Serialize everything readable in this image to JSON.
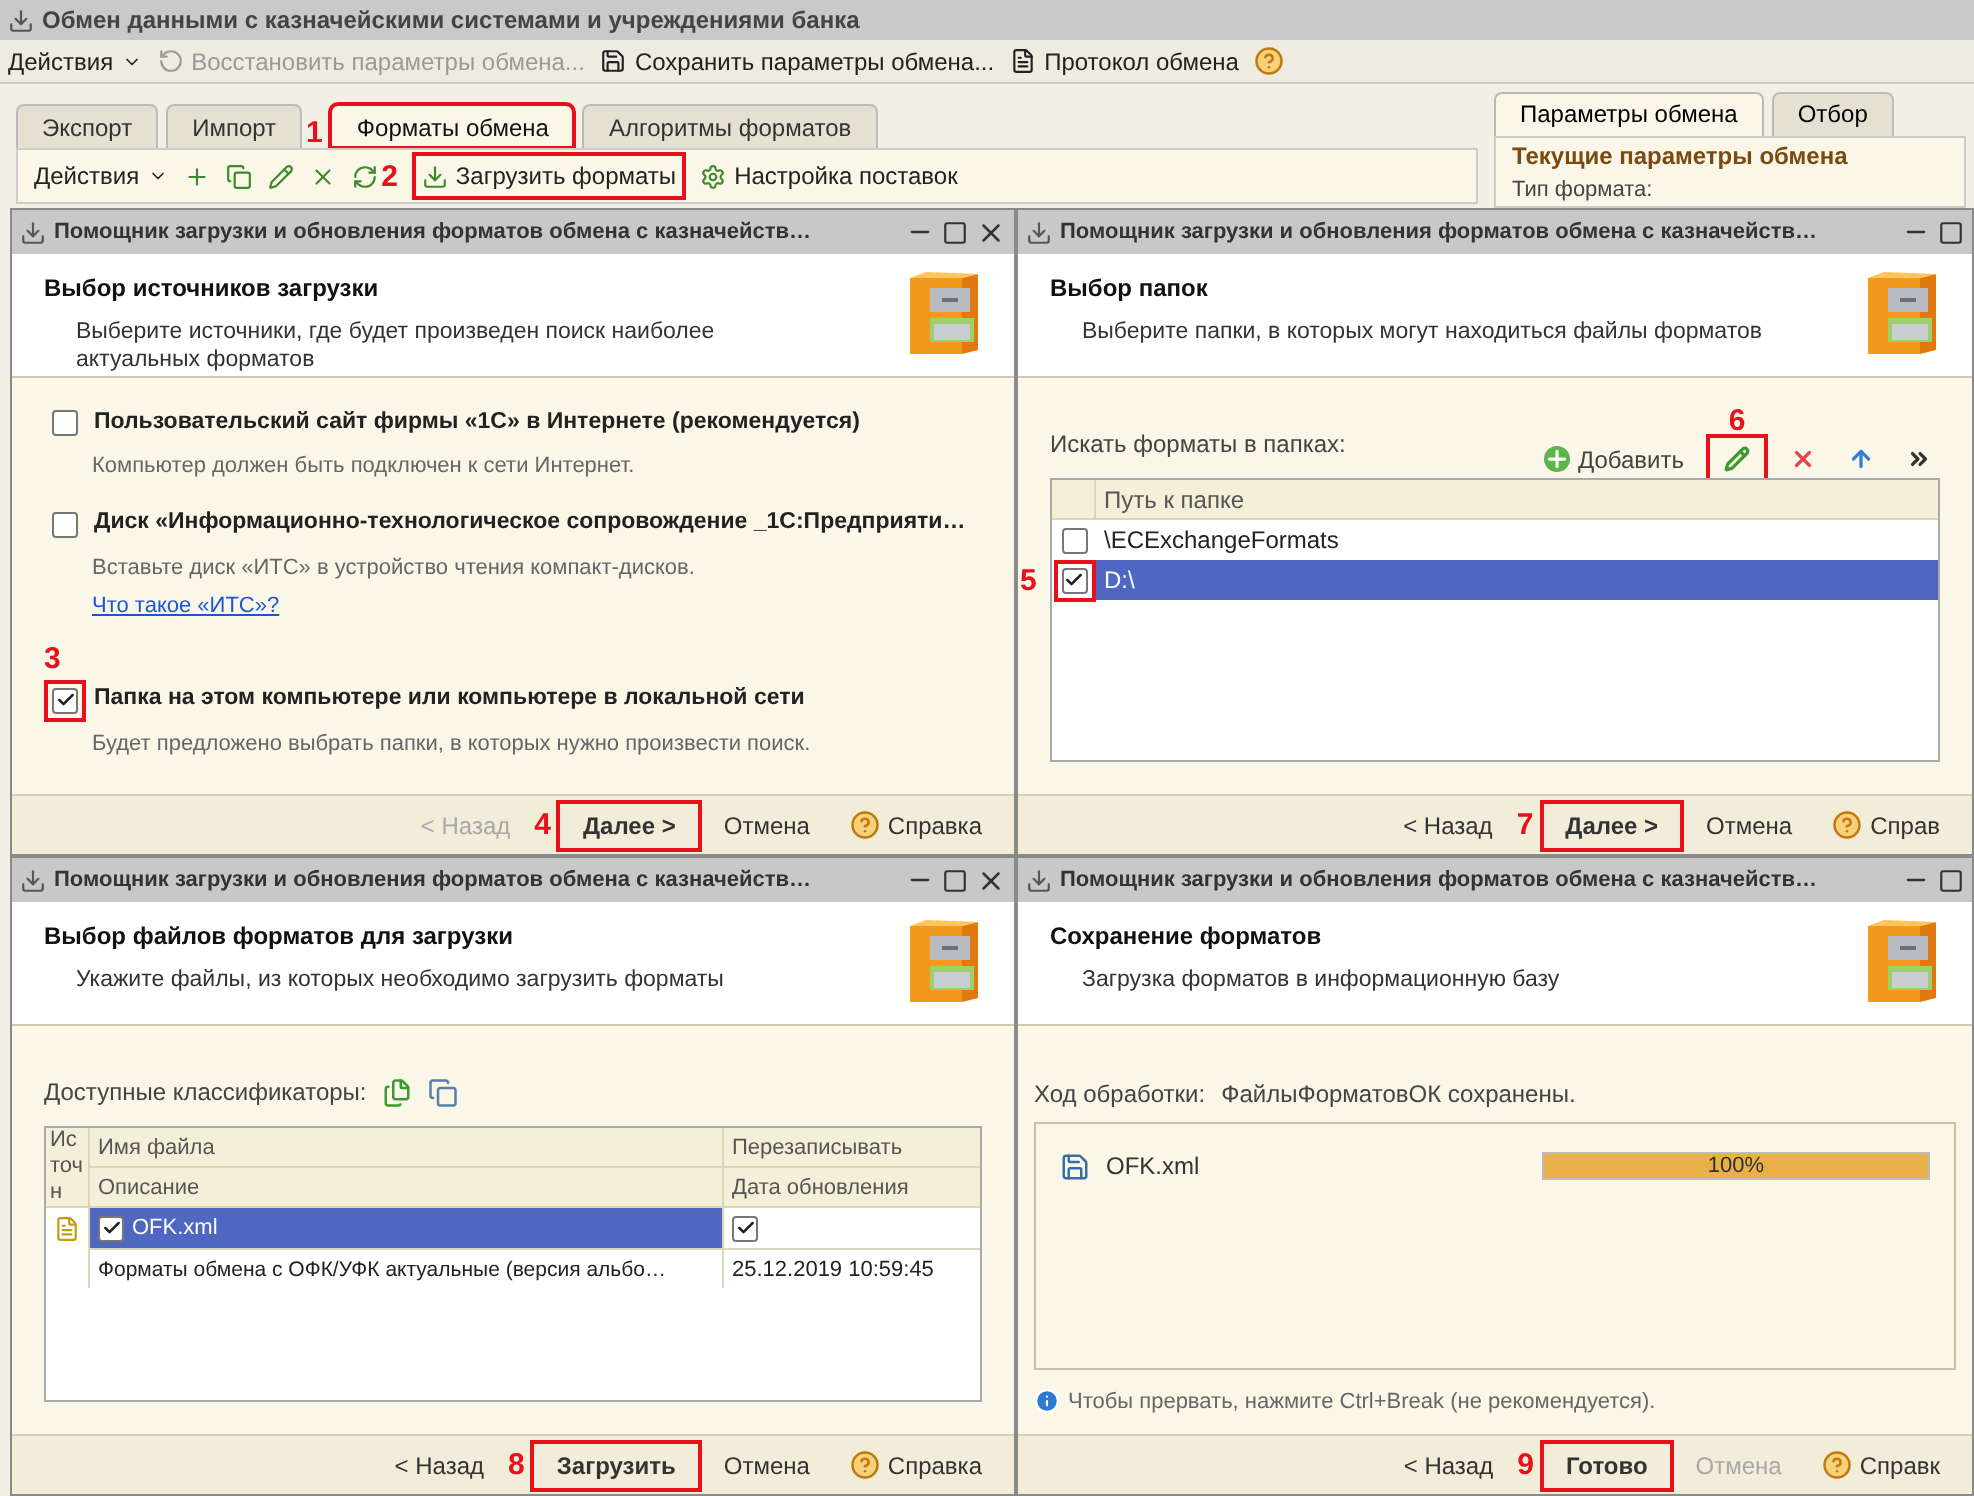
{
  "window": {
    "title": "Обмен данными с казначейскими системами и учреждениями банка"
  },
  "toolbar": [
    {
      "kind": "menu",
      "label": "Действия",
      "disabled": false
    },
    {
      "kind": "restore",
      "label": "Восстановить параметры обмена...",
      "disabled": true
    },
    {
      "kind": "save",
      "label": "Сохранить параметры обмена...",
      "disabled": false
    },
    {
      "kind": "log",
      "label": "Протокол обмена",
      "disabled": false
    },
    {
      "kind": "help"
    }
  ],
  "tabs": [
    {
      "label": "Экспорт",
      "selected": false,
      "highlighted": false
    },
    {
      "label": "Импорт",
      "selected": false,
      "highlighted": false
    },
    {
      "label": "Форматы обмена",
      "selected": true,
      "highlighted": true,
      "marker": "1"
    },
    {
      "label": "Алгоритмы форматов",
      "selected": false,
      "highlighted": false
    }
  ],
  "subtoolbar": [
    {
      "kind": "menu",
      "label": "Действия",
      "highlighted": false
    },
    {
      "kind": "add",
      "highlighted": false
    },
    {
      "kind": "copy",
      "highlighted": false
    },
    {
      "kind": "edit",
      "highlighted": false
    },
    {
      "kind": "delete",
      "highlighted": false
    },
    {
      "kind": "refresh",
      "highlighted": false
    },
    {
      "kind": "load",
      "label": "Загрузить форматы",
      "highlighted": true,
      "marker": "2"
    },
    {
      "kind": "settings",
      "label": "Настройка поставок",
      "highlighted": false
    }
  ],
  "side_panel": {
    "tabs": [
      {
        "label": "Параметры обмена",
        "selected": true
      },
      {
        "label": "Отбор",
        "selected": false
      }
    ],
    "heading": "Текущие параметры обмена",
    "field_label": "Тип формата:"
  },
  "wizards": [
    {
      "kind": "sources",
      "title": "Помощник загрузки и обновления форматов обмена с казначейств…",
      "heading": "Выбор источников загрузки",
      "subtitle": "Выберите источники, где будет произведен поиск наиболее актуальных форматов",
      "options": [
        {
          "label": "Пользовательский сайт фирмы «1С» в Интернете (рекомендуется)",
          "checked": false,
          "hint": "Компьютер должен быть подключен к сети Интернет."
        },
        {
          "label": "Диск «Информационно-технологическое сопровождение _1С:Предприяти…",
          "checked": false,
          "hint": "Вставьте диск «ИТС» в устройство чтения компакт-дисков.",
          "link": "Что такое «ИТС»?"
        },
        {
          "label": "Папка на этом компьютере или компьютере в локальной сети",
          "checked": true,
          "highlighted": true,
          "marker": "3",
          "hint": "Будет предложено выбрать папки, в которых нужно произвести поиск."
        }
      ],
      "buttons": [
        {
          "kind": "back",
          "label": "< Назад",
          "disabled": true,
          "default": false,
          "highlighted": false
        },
        {
          "kind": "next",
          "label": "Далее >",
          "disabled": false,
          "default": true,
          "highlighted": true,
          "marker": "4"
        },
        {
          "kind": "cancel",
          "label": "Отмена",
          "disabled": false,
          "default": false,
          "highlighted": false
        },
        {
          "kind": "help",
          "label": "Справка",
          "disabled": false,
          "default": false,
          "highlighted": false
        }
      ]
    },
    {
      "kind": "folders",
      "title": "Помощник загрузки и обновления форматов обмена с казначейств…",
      "heading": "Выбор папок",
      "subtitle": "Выберите папки, в которых могут находиться файлы форматов",
      "list_label": "Искать форматы в папках:",
      "actions": [
        {
          "kind": "add",
          "label": "Добавить",
          "highlighted": false
        },
        {
          "kind": "edit",
          "highlighted": true,
          "marker": "6"
        },
        {
          "kind": "delete",
          "highlighted": false
        },
        {
          "kind": "up",
          "highlighted": false
        },
        {
          "kind": "more",
          "highlighted": false
        }
      ],
      "column": "Путь к папке",
      "rows": [
        {
          "path": "\\ECExchangeFormats",
          "checked": false,
          "selected": false
        },
        {
          "path": "D:\\",
          "checked": true,
          "selected": true,
          "highlighted": true,
          "marker": "5"
        }
      ],
      "buttons": [
        {
          "kind": "back",
          "label": "< Назад",
          "disabled": false,
          "default": false,
          "highlighted": false
        },
        {
          "kind": "next",
          "label": "Далее >",
          "disabled": false,
          "default": true,
          "highlighted": true,
          "marker": "7"
        },
        {
          "kind": "cancel",
          "label": "Отмена",
          "disabled": false,
          "default": false,
          "highlighted": false
        },
        {
          "kind": "help",
          "label": "Справ",
          "disabled": false,
          "default": false,
          "highlighted": false
        }
      ]
    },
    {
      "kind": "files",
      "title": "Помощник загрузки и обновления форматов обмена с казначейств…",
      "heading": "Выбор файлов форматов для загрузки",
      "subtitle": "Укажите файлы, из которых необходимо загрузить форматы",
      "list_label": "Доступные классификаторы:",
      "columns": [
        "Источн",
        "Имя файла",
        "Перезаписывать",
        "Описание",
        "Дата обновления"
      ],
      "rows": [
        {
          "file": "OFK.xml",
          "checked": true,
          "overwrite": true,
          "selected": true,
          "description": "Форматы обмена с ОФК/УФК актуальные (версия альбо…",
          "date": "25.12.2019 10:59:45"
        }
      ],
      "buttons": [
        {
          "kind": "back",
          "label": "< Назад",
          "disabled": false,
          "default": false,
          "highlighted": false
        },
        {
          "kind": "load",
          "label": "Загрузить",
          "disabled": false,
          "default": true,
          "highlighted": true,
          "marker": "8"
        },
        {
          "kind": "cancel",
          "label": "Отмена",
          "disabled": false,
          "default": false,
          "highlighted": false
        },
        {
          "kind": "help",
          "label": "Справка",
          "disabled": false,
          "default": false,
          "highlighted": false
        }
      ]
    },
    {
      "kind": "progress",
      "title": "Помощник загрузки и обновления форматов обмена с казначейств…",
      "heading": "Сохранение форматов",
      "subtitle": "Загрузка форматов в информационную базу",
      "progress_label": "Ход обработки:",
      "status": "ФайлыФорматовОК сохранены.",
      "items": [
        {
          "name": "OFK.xml",
          "level": 1,
          "reading": "100%"
        }
      ],
      "note": "Чтобы прервать, нажмите Ctrl+Break (не рекомендуется).",
      "buttons": [
        {
          "kind": "back",
          "label": "< Назад",
          "disabled": false,
          "default": false,
          "highlighted": false
        },
        {
          "kind": "done",
          "label": "Готово",
          "disabled": false,
          "default": true,
          "highlighted": true,
          "marker": "9"
        },
        {
          "kind": "cancel",
          "label": "Отмена",
          "disabled": true,
          "default": false,
          "highlighted": false
        },
        {
          "kind": "help",
          "label": "Справк",
          "disabled": false,
          "default": false,
          "highlighted": false
        }
      ]
    }
  ]
}
